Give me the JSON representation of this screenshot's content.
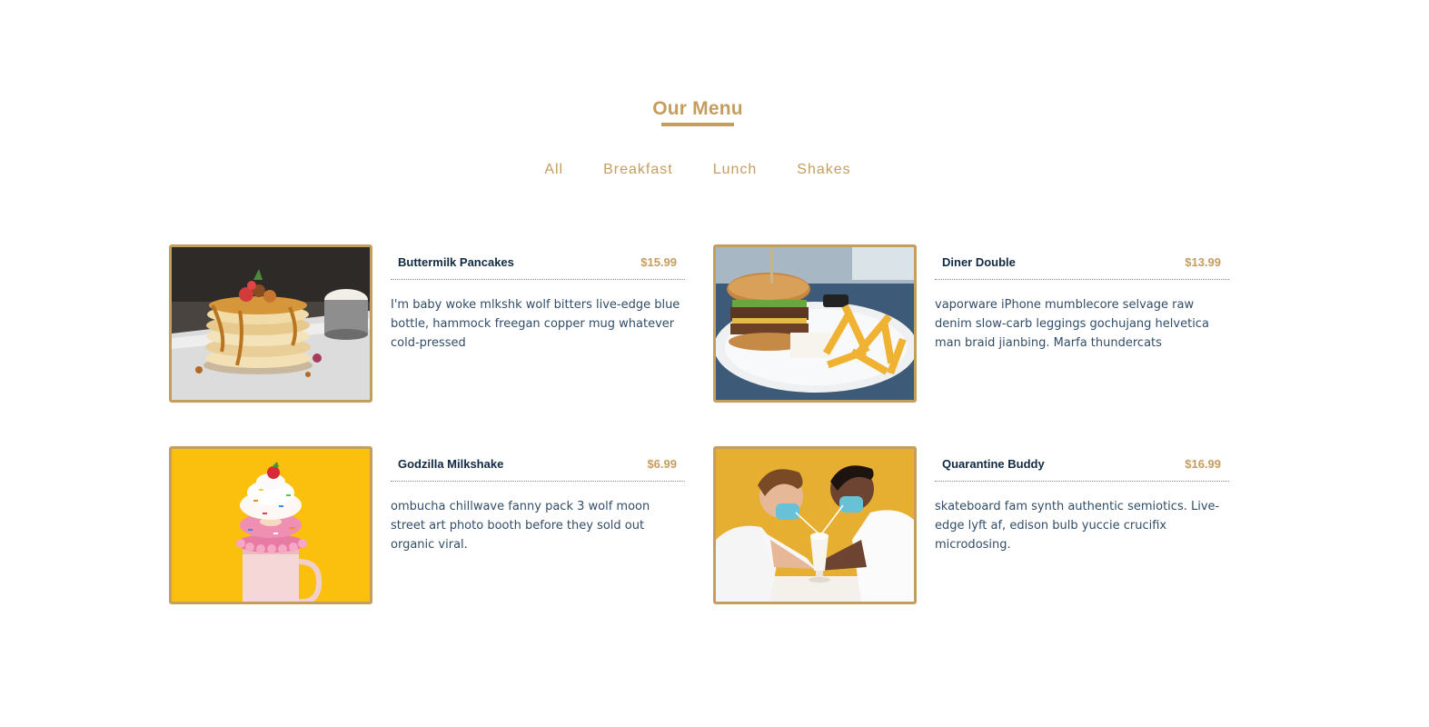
{
  "section": {
    "title": "Our Menu"
  },
  "filters": [
    {
      "label": "All"
    },
    {
      "label": "Breakfast"
    },
    {
      "label": "Lunch"
    },
    {
      "label": "Shakes"
    }
  ],
  "items": [
    {
      "name": "Buttermilk Pancakes",
      "price": "$15.99",
      "description": "I'm baby woke mlkshk wolf bitters live-edge blue bottle, hammock freegan copper mug whatever cold-pressed",
      "photo": "pancakes-photo"
    },
    {
      "name": "Diner Double",
      "price": "$13.99",
      "description": "vaporware iPhone mumblecore selvage raw denim slow-carb leggings gochujang helvetica man braid jianbing. Marfa thundercats",
      "photo": "burger-photo"
    },
    {
      "name": "Godzilla Milkshake",
      "price": "$6.99",
      "description": "ombucha chillwave fanny pack 3 wolf moon street art photo booth before they sold out organic viral.",
      "photo": "milkshake-photo"
    },
    {
      "name": "Quarantine Buddy",
      "price": "$16.99",
      "description": "skateboard fam synth authentic semiotics. Live-edge lyft af, edison bulb yuccie crucifix microdosing.",
      "photo": "couple-milkshake-photo"
    }
  ],
  "colors": {
    "accent": "#c59d5f",
    "heading": "#102a43",
    "text": "#324d67"
  }
}
